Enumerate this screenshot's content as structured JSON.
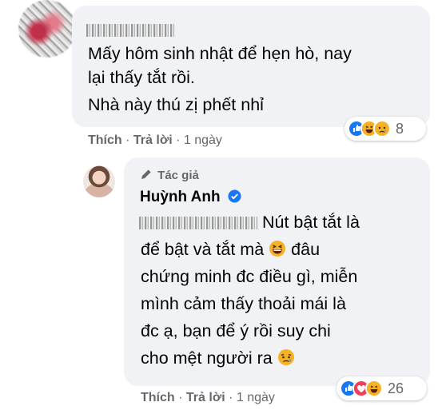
{
  "comment1": {
    "lines": [
      "Mấy hôm sinh nhật để hẹn hò, nay",
      "lại thấy tắt rồi.",
      "Nhà này thú zị phết nhỉ"
    ],
    "actions": {
      "like": "Thích",
      "sep1": "·",
      "reply": "Trả lời",
      "sep2": "·",
      "time": "1 ngày"
    },
    "reactions": {
      "icons": [
        "like-reaction-icon",
        "haha-reaction-icon",
        "sad-reaction-icon"
      ],
      "count": "8"
    }
  },
  "reply": {
    "badge": "Tác giả",
    "author": "Huỳnh Anh",
    "line1_text": "Nút bật tắt là",
    "line2_pre": "để bật và tắt mà",
    "line2_post": "đâu",
    "line3": "chứng minh đc điều gì, miễn",
    "line4": "mình cảm thấy thoải mái là",
    "line5": "đc ạ, bạn để ý rồi suy chi",
    "line6_pre": "cho mệt người ra",
    "actions": {
      "like": "Thích",
      "sep1": "·",
      "reply": "Trả lời",
      "sep2": "·",
      "time": "1 ngày"
    },
    "reactions": {
      "icons": [
        "like-reaction-icon",
        "love-reaction-icon",
        "haha-reaction-icon"
      ],
      "count": "26"
    }
  },
  "colors": {
    "bubble": "#f0f2f5",
    "meta": "#65676b",
    "like_blue": "#1877f2",
    "love_red": "#f33e58",
    "emoji_yellow": "#f7b125"
  }
}
